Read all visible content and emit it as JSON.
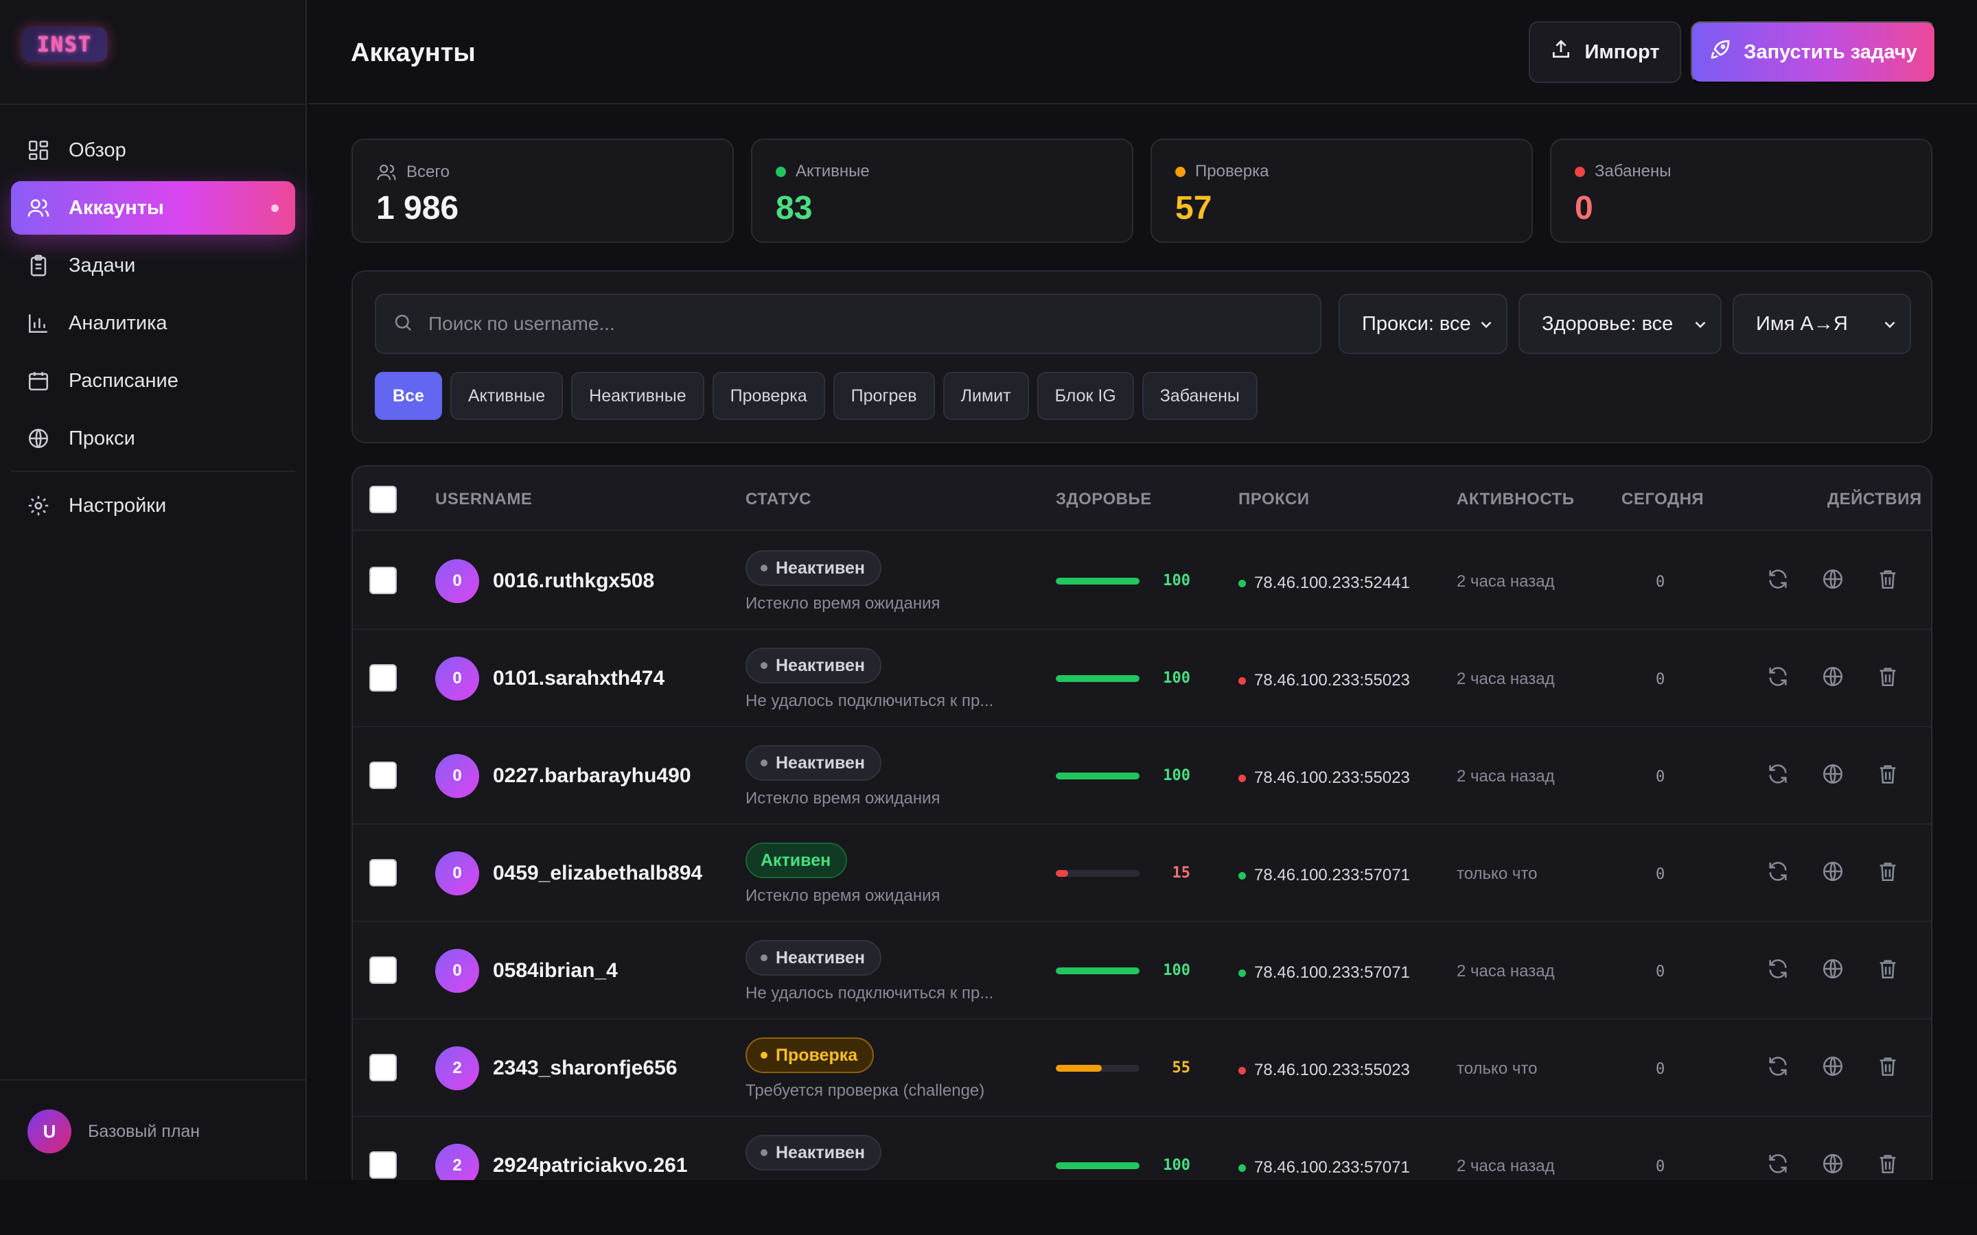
{
  "app": {
    "logo_text": "INST",
    "page_title": "Аккаунты"
  },
  "header": {
    "import_label": "Импорт",
    "run_label": "Запустить задачу"
  },
  "sidebar": {
    "items": [
      {
        "label": "Обзор",
        "icon": "dashboard-icon",
        "active": false
      },
      {
        "label": "Аккаунты",
        "icon": "users-icon",
        "active": true
      },
      {
        "label": "Задачи",
        "icon": "clipboard-icon",
        "active": false
      },
      {
        "label": "Аналитика",
        "icon": "bar-chart-icon",
        "active": false
      },
      {
        "label": "Расписание",
        "icon": "calendar-icon",
        "active": false
      },
      {
        "label": "Прокси",
        "icon": "globe-icon",
        "active": false
      }
    ],
    "settings_label": "Настройки",
    "user_initial": "U",
    "plan_label": "Базовый план"
  },
  "stats": {
    "total": {
      "label": "Всего",
      "value": "1 986"
    },
    "active": {
      "label": "Активные",
      "value": "83",
      "color": "#4ade80"
    },
    "checking": {
      "label": "Проверка",
      "value": "57",
      "color": "#fbbf24"
    },
    "banned": {
      "label": "Забанены",
      "value": "0",
      "color": "#f87171"
    }
  },
  "filters": {
    "search_placeholder": "Поиск по username...",
    "proxy_select": "Прокси: все",
    "health_select": "Здоровье: все",
    "sort_select": "Имя А→Я",
    "chips": [
      "Все",
      "Активные",
      "Неактивные",
      "Проверка",
      "Прогрев",
      "Лимит",
      "Блок IG",
      "Забанены"
    ],
    "active_chip": "Все"
  },
  "table": {
    "columns": {
      "username": "USERNAME",
      "status": "СТАТУС",
      "health": "ЗДОРОВЬЕ",
      "proxy": "ПРОКСИ",
      "activity": "АКТИВНОСТЬ",
      "today": "СЕГОДНЯ",
      "actions": "ДЕЙСТВИЯ"
    },
    "rows": [
      {
        "avatar": "0",
        "username": "0016.ruthkgx508",
        "status": "Неактивен",
        "status_kind": "inactive",
        "note": "Истекло время ожидания",
        "health": 100,
        "health_label": "100",
        "proxy": "78.46.100.233:52441",
        "proxy_ok": true,
        "activity": "2 часа назад",
        "today": "0"
      },
      {
        "avatar": "0",
        "username": "0101.sarahxth474",
        "status": "Неактивен",
        "status_kind": "inactive",
        "note": "Не удалось подключиться к пр...",
        "health": 100,
        "health_label": "100",
        "proxy": "78.46.100.233:55023",
        "proxy_ok": false,
        "activity": "2 часа назад",
        "today": "0"
      },
      {
        "avatar": "0",
        "username": "0227.barbarayhu490",
        "status": "Неактивен",
        "status_kind": "inactive",
        "note": "Истекло время ожидания",
        "health": 100,
        "health_label": "100",
        "proxy": "78.46.100.233:55023",
        "proxy_ok": false,
        "activity": "2 часа назад",
        "today": "0"
      },
      {
        "avatar": "0",
        "username": "0459_elizabethalb894",
        "status": "Активен",
        "status_kind": "active",
        "note": "Истекло время ожидания",
        "health": 15,
        "health_label": "15",
        "proxy": "78.46.100.233:57071",
        "proxy_ok": true,
        "activity": "только что",
        "today": "0"
      },
      {
        "avatar": "0",
        "username": "0584ibrian_4",
        "status": "Неактивен",
        "status_kind": "inactive",
        "note": "Не удалось подключиться к пр...",
        "health": 100,
        "health_label": "100",
        "proxy": "78.46.100.233:57071",
        "proxy_ok": true,
        "activity": "2 часа назад",
        "today": "0"
      },
      {
        "avatar": "2",
        "username": "2343_sharonfje656",
        "status": "Проверка",
        "status_kind": "check",
        "note": "Требуется проверка (challenge)",
        "health": 55,
        "health_label": "55",
        "proxy": "78.46.100.233:55023",
        "proxy_ok": false,
        "activity": "только что",
        "today": "0"
      },
      {
        "avatar": "2",
        "username": "2924patriciakvo.261",
        "status": "Неактивен",
        "status_kind": "inactive",
        "note": "",
        "health": 100,
        "health_label": "100",
        "proxy": "78.46.100.233:57071",
        "proxy_ok": true,
        "activity": "2 часа назад",
        "today": "0"
      }
    ]
  },
  "colors": {
    "accent": "#8b5cf6",
    "pink": "#ec4899",
    "ok": "#22c55e",
    "warn": "#f59e0b",
    "bad": "#ef4444"
  }
}
